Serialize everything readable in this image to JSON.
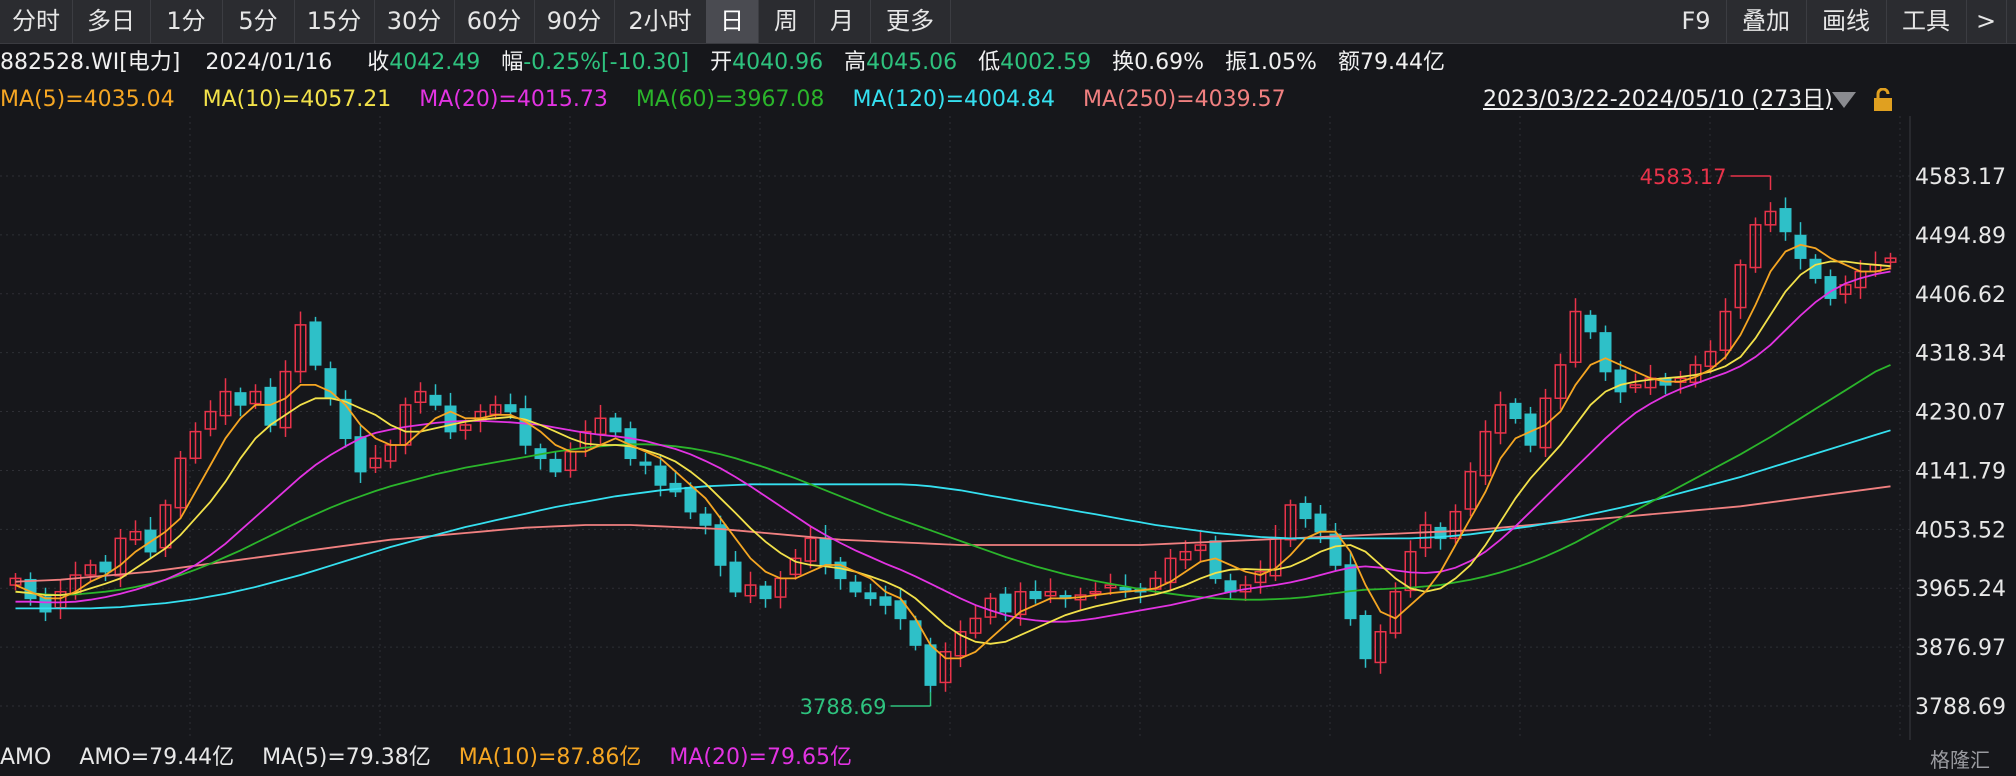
{
  "toolbar": {
    "tabs": [
      "分时",
      "多日",
      "1分",
      "5分",
      "15分",
      "30分",
      "60分",
      "90分",
      "2小时",
      "日",
      "周",
      "月",
      "更多"
    ],
    "active_tab": "日",
    "right": [
      "F9",
      "叠加",
      "画线",
      "工具",
      ">"
    ]
  },
  "info": {
    "code": "882528.WI[电力]",
    "date": "2024/01/16",
    "close_label": "收",
    "close": "4042.49",
    "change_label": "幅",
    "change": "-0.25%[-10.30]",
    "open_label": "开",
    "open": "4040.96",
    "high_label": "高",
    "high": "4045.06",
    "low_label": "低",
    "low": "4002.59",
    "turnover_label": "换",
    "turnover": "0.69%",
    "amplitude_label": "振",
    "amplitude": "1.05%",
    "amount_label": "额",
    "amount": "79.44亿"
  },
  "ma_legend": [
    {
      "text": "MA(5)=4035.04",
      "color": "#f5a623"
    },
    {
      "text": "MA(10)=4057.21",
      "color": "#f2e14a"
    },
    {
      "text": "MA(20)=4015.73",
      "color": "#e233e2"
    },
    {
      "text": "MA(60)=3967.08",
      "color": "#2bb52b"
    },
    {
      "text": "MA(120)=4004.84",
      "color": "#35e0f0"
    },
    {
      "text": "MA(250)=4039.57",
      "color": "#f08080"
    }
  ],
  "range_text": "2023/03/22-2024/05/10 (273日)",
  "amo_legend": [
    {
      "text": "AMO",
      "color": "#e8e8e8"
    },
    {
      "text": "AMO=79.44亿",
      "color": "#e8e8e8"
    },
    {
      "text": "MA(5)=79.38亿",
      "color": "#e8e8e8"
    },
    {
      "text": "MA(10)=87.86亿",
      "color": "#f5a623"
    },
    {
      "text": "MA(20)=79.65亿",
      "color": "#e233e2"
    }
  ],
  "logo": "格隆汇",
  "chart_data": {
    "type": "line",
    "title": "",
    "ylim": [
      3788.69,
      4583.17
    ],
    "y_ticks": [
      "4583.17",
      "4494.89",
      "4406.62",
      "4318.34",
      "4230.07",
      "4141.79",
      "4053.52",
      "3965.24",
      "3876.97",
      "3788.69"
    ],
    "max_annotation": "4583.17",
    "min_annotation": "3788.69",
    "colors": {
      "up": "#e8334a",
      "down": "#2ec0c8"
    },
    "close": [
      3980,
      3950,
      3930,
      3960,
      3985,
      4000,
      3990,
      4040,
      4050,
      4020,
      4090,
      4160,
      4200,
      4230,
      4260,
      4240,
      4260,
      4210,
      4290,
      4360,
      4300,
      4250,
      4190,
      4140,
      4160,
      4180,
      4240,
      4260,
      4240,
      4200,
      4210,
      4230,
      4240,
      4230,
      4180,
      4160,
      4140,
      4170,
      4200,
      4220,
      4200,
      4160,
      4150,
      4120,
      4110,
      4080,
      4060,
      4000,
      3960,
      3970,
      3950,
      3980,
      4010,
      4040,
      4000,
      3980,
      3960,
      3950,
      3940,
      3920,
      3880,
      3820,
      3870,
      3900,
      3920,
      3950,
      3930,
      3960,
      3950,
      3960,
      3950,
      3955,
      3960,
      3970,
      3965,
      3960,
      3980,
      4010,
      4020,
      4030,
      3980,
      3960,
      3970,
      3990,
      4040,
      4090,
      4070,
      4050,
      4000,
      3920,
      3860,
      3900,
      3960,
      4020,
      4060,
      4040,
      4080,
      4140,
      4200,
      4240,
      4220,
      4180,
      4250,
      4300,
      4380,
      4350,
      4290,
      4260,
      4270,
      4280,
      4270,
      4280,
      4300,
      4320,
      4380,
      4450,
      4510,
      4530,
      4500,
      4460,
      4430,
      4400,
      4420,
      4440,
      4450,
      4460
    ],
    "ma5": [
      3970,
      3960,
      3950,
      3950,
      3960,
      3975,
      3985,
      4000,
      4020,
      4035,
      4050,
      4070,
      4110,
      4150,
      4190,
      4220,
      4240,
      4240,
      4250,
      4270,
      4270,
      4260,
      4240,
      4210,
      4190,
      4180,
      4180,
      4200,
      4220,
      4230,
      4220,
      4220,
      4225,
      4225,
      4215,
      4200,
      4180,
      4170,
      4170,
      4180,
      4190,
      4180,
      4170,
      4160,
      4140,
      4120,
      4100,
      4070,
      4040,
      4010,
      3990,
      3980,
      3980,
      3990,
      4000,
      4000,
      3990,
      3980,
      3960,
      3950,
      3920,
      3880,
      3860,
      3860,
      3870,
      3890,
      3910,
      3930,
      3940,
      3950,
      3950,
      3952,
      3955,
      3958,
      3960,
      3962,
      3965,
      3975,
      3990,
      4005,
      4010,
      4000,
      3990,
      3985,
      3995,
      4015,
      4040,
      4050,
      4050,
      4020,
      3970,
      3930,
      3920,
      3940,
      3960,
      3990,
      4030,
      4070,
      4110,
      4160,
      4190,
      4200,
      4210,
      4230,
      4270,
      4300,
      4310,
      4300,
      4290,
      4280,
      4275,
      4275,
      4282,
      4293,
      4312,
      4345,
      4390,
      4440,
      4470,
      4480,
      4475,
      4460,
      4450,
      4440,
      4440,
      4445
    ],
    "ma10": [
      3960,
      3958,
      3955,
      3955,
      3958,
      3965,
      3972,
      3980,
      3995,
      4010,
      4025,
      4045,
      4070,
      4095,
      4125,
      4160,
      4190,
      4210,
      4225,
      4240,
      4250,
      4250,
      4245,
      4235,
      4225,
      4210,
      4200,
      4200,
      4205,
      4210,
      4215,
      4218,
      4220,
      4222,
      4218,
      4210,
      4200,
      4190,
      4182,
      4180,
      4180,
      4178,
      4172,
      4165,
      4155,
      4140,
      4122,
      4100,
      4078,
      4055,
      4035,
      4018,
      4005,
      4000,
      3998,
      3995,
      3990,
      3983,
      3975,
      3965,
      3950,
      3930,
      3910,
      3895,
      3885,
      3882,
      3885,
      3895,
      3905,
      3915,
      3925,
      3932,
      3938,
      3943,
      3948,
      3952,
      3956,
      3962,
      3970,
      3980,
      3988,
      3993,
      3994,
      3993,
      3993,
      3998,
      4008,
      4020,
      4028,
      4030,
      4020,
      4000,
      3980,
      3965,
      3960,
      3965,
      3980,
      4000,
      4030,
      4065,
      4100,
      4130,
      4155,
      4180,
      4210,
      4240,
      4260,
      4270,
      4275,
      4278,
      4280,
      4282,
      4285,
      4290,
      4298,
      4312,
      4340,
      4375,
      4410,
      4435,
      4450,
      4455,
      4455,
      4452,
      4450,
      4448
    ],
    "ma20": [
      3945,
      3945,
      3944,
      3944,
      3945,
      3948,
      3952,
      3957,
      3963,
      3970,
      3978,
      3988,
      4000,
      4015,
      4032,
      4052,
      4072,
      4092,
      4112,
      4132,
      4150,
      4165,
      4178,
      4190,
      4198,
      4203,
      4207,
      4210,
      4213,
      4215,
      4216,
      4216,
      4215,
      4214,
      4212,
      4210,
      4206,
      4202,
      4198,
      4195,
      4193,
      4190,
      4186,
      4180,
      4174,
      4166,
      4156,
      4145,
      4132,
      4118,
      4103,
      4088,
      4073,
      4058,
      4045,
      4033,
      4022,
      4012,
      4002,
      3993,
      3983,
      3972,
      3961,
      3950,
      3940,
      3932,
      3925,
      3920,
      3917,
      3915,
      3915,
      3917,
      3920,
      3924,
      3928,
      3932,
      3936,
      3940,
      3945,
      3950,
      3955,
      3960,
      3964,
      3967,
      3970,
      3974,
      3979,
      3985,
      3991,
      3996,
      3998,
      3996,
      3992,
      3989,
      3988,
      3990,
      3996,
      4006,
      4020,
      4038,
      4058,
      4080,
      4102,
      4124,
      4146,
      4168,
      4190,
      4210,
      4228,
      4242,
      4254,
      4264,
      4272,
      4280,
      4288,
      4298,
      4312,
      4330,
      4352,
      4374,
      4394,
      4410,
      4422,
      4430,
      4436,
      4440
    ],
    "ma60": [
      3960,
      3958,
      3956,
      3955,
      3956,
      3958,
      3960,
      3963,
      3967,
      3972,
      3978,
      3985,
      3993,
      4002,
      4012,
      4022,
      4033,
      4044,
      4055,
      4066,
      4076,
      4086,
      4095,
      4103,
      4111,
      4118,
      4124,
      4130,
      4136,
      4141,
      4146,
      4150,
      4154,
      4158,
      4162,
      4166,
      4170,
      4173,
      4176,
      4178,
      4180,
      4181,
      4181,
      4180,
      4178,
      4175,
      4171,
      4166,
      4160,
      4153,
      4146,
      4138,
      4130,
      4121,
      4112,
      4103,
      4094,
      4085,
      4076,
      4068,
      4060,
      4052,
      4044,
      4036,
      4028,
      4020,
      4012,
      4005,
      3998,
      3992,
      3986,
      3981,
      3976,
      3972,
      3968,
      3964,
      3960,
      3957,
      3954,
      3952,
      3950,
      3949,
      3948,
      3948,
      3949,
      3950,
      3952,
      3955,
      3958,
      3961,
      3963,
      3964,
      3965,
      3966,
      3968,
      3970,
      3974,
      3978,
      3983,
      3989,
      3996,
      4004,
      4013,
      4023,
      4034,
      4046,
      4058,
      4070,
      4082,
      4094,
      4106,
      4118,
      4130,
      4142,
      4154,
      4166,
      4179,
      4192,
      4206,
      4220,
      4234,
      4248,
      4262,
      4276,
      4290,
      4300
    ],
    "ma120": [
      3935,
      3935,
      3935,
      3935,
      3935,
      3935,
      3936,
      3937,
      3939,
      3941,
      3943,
      3946,
      3949,
      3953,
      3957,
      3962,
      3967,
      3973,
      3979,
      3985,
      3992,
      3999,
      4006,
      4013,
      4020,
      4027,
      4033,
      4039,
      4045,
      4051,
      4057,
      4062,
      4067,
      4072,
      4077,
      4082,
      4087,
      4091,
      4095,
      4099,
      4103,
      4106,
      4109,
      4112,
      4114,
      4116,
      4118,
      4119,
      4120,
      4121,
      4121,
      4121,
      4121,
      4121,
      4121,
      4121,
      4121,
      4121,
      4121,
      4121,
      4120,
      4118,
      4115,
      4112,
      4108,
      4104,
      4100,
      4096,
      4092,
      4088,
      4084,
      4080,
      4076,
      4072,
      4068,
      4064,
      4060,
      4057,
      4054,
      4051,
      4048,
      4046,
      4044,
      4042,
      4041,
      4040,
      4040,
      4040,
      4040,
      4040,
      4040,
      4040,
      4040,
      4040,
      4041,
      4042,
      4044,
      4046,
      4049,
      4052,
      4055,
      4058,
      4062,
      4066,
      4071,
      4076,
      4081,
      4086,
      4091,
      4096,
      4102,
      4108,
      4114,
      4120,
      4126,
      4132,
      4139,
      4146,
      4153,
      4160,
      4167,
      4174,
      4181,
      4188,
      4195,
      4202
    ],
    "ma250": [
      3975,
      3976,
      3977,
      3978,
      3980,
      3982,
      3984,
      3986,
      3988,
      3990,
      3993,
      3996,
      3999,
      4002,
      4005,
      4008,
      4011,
      4014,
      4017,
      4020,
      4023,
      4026,
      4029,
      4032,
      4035,
      4038,
      4040,
      4042,
      4044,
      4046,
      4048,
      4050,
      4052,
      4054,
      4056,
      4057,
      4058,
      4059,
      4060,
      4060,
      4060,
      4060,
      4059,
      4058,
      4057,
      4056,
      4055,
      4054,
      4052,
      4050,
      4048,
      4046,
      4044,
      4042,
      4040,
      4038,
      4037,
      4036,
      4035,
      4034,
      4033,
      4032,
      4031,
      4030,
      4030,
      4030,
      4030,
      4030,
      4030,
      4030,
      4030,
      4030,
      4030,
      4030,
      4030,
      4030,
      4031,
      4032,
      4033,
      4034,
      4035,
      4036,
      4037,
      4038,
      4039,
      4040,
      4041,
      4042,
      4043,
      4044,
      4045,
      4046,
      4047,
      4048,
      4049,
      4050,
      4051,
      4052,
      4054,
      4056,
      4058,
      4060,
      4062,
      4064,
      4066,
      4068,
      4070,
      4072,
      4074,
      4076,
      4078,
      4080,
      4082,
      4084,
      4086,
      4088,
      4091,
      4094,
      4097,
      4100,
      4103,
      4106,
      4109,
      4112,
      4115,
      4118
    ]
  }
}
